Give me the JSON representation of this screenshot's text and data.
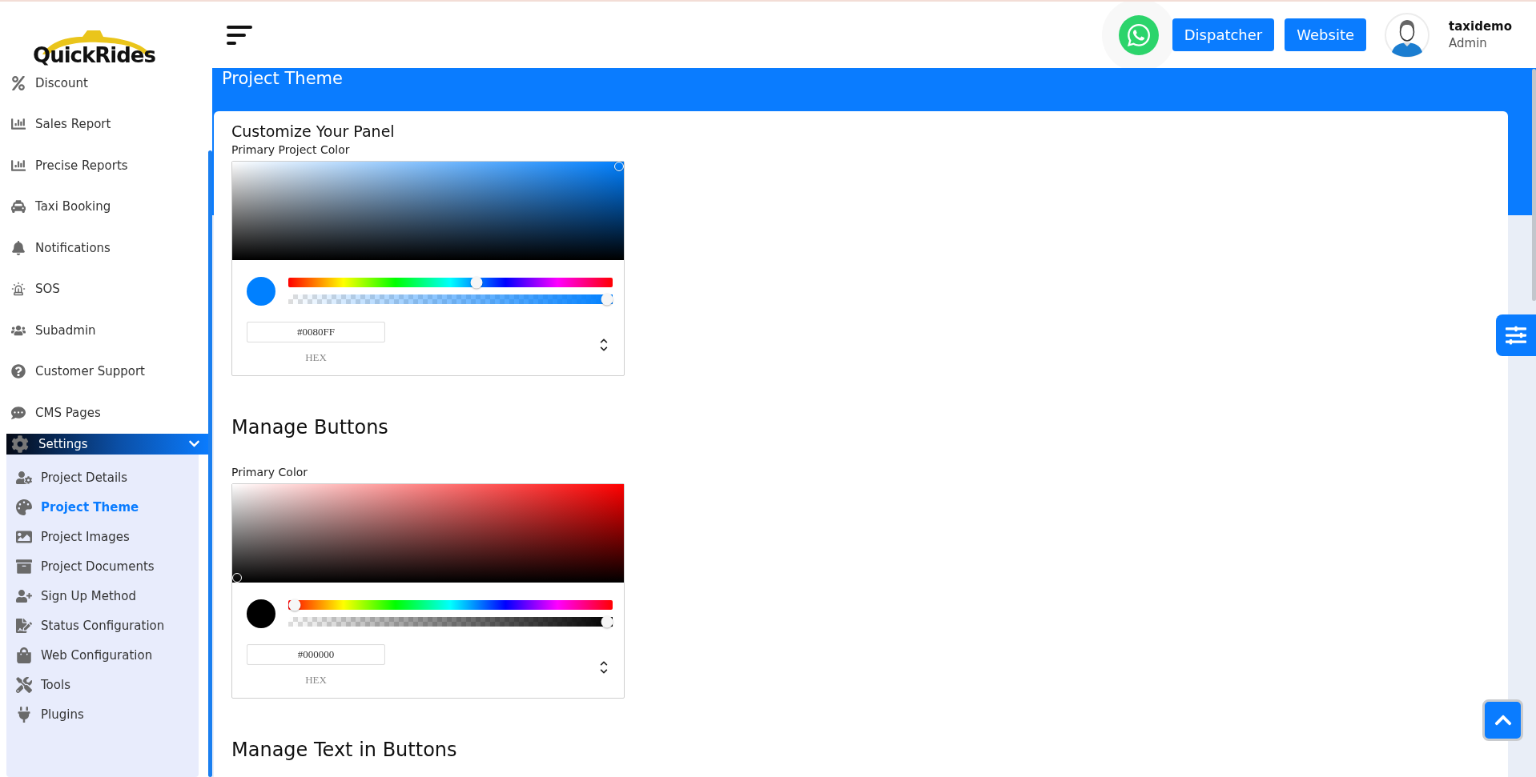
{
  "logo": {
    "text": "QuickRides"
  },
  "header": {
    "buttons": [
      "Dispatcher",
      "Website"
    ],
    "user": {
      "name": "taxidemo",
      "role": "Admin"
    }
  },
  "sidebar": {
    "items": [
      {
        "label": "Discount",
        "selected": false
      },
      {
        "label": "Sales Report",
        "selected": false
      },
      {
        "label": "Precise Reports",
        "selected": false
      },
      {
        "label": "Taxi Booking",
        "selected": false
      },
      {
        "label": "Notifications",
        "selected": false
      },
      {
        "label": "SOS",
        "selected": false
      },
      {
        "label": "Subadmin",
        "selected": false
      },
      {
        "label": "Customer Support",
        "selected": false
      },
      {
        "label": "CMS Pages",
        "selected": false
      }
    ],
    "settings": {
      "label": "Settings",
      "selected": true,
      "expanded": true,
      "children": [
        {
          "label": "Project Details",
          "selected": false
        },
        {
          "label": "Project Theme",
          "selected": true
        },
        {
          "label": "Project Images",
          "selected": false
        },
        {
          "label": "Project Documents",
          "selected": false
        },
        {
          "label": "Sign Up Method",
          "selected": false
        },
        {
          "label": "Status Configuration",
          "selected": false
        },
        {
          "label": "Web Configuration",
          "selected": false
        },
        {
          "label": "Tools",
          "selected": false
        },
        {
          "label": "Plugins",
          "selected": false
        }
      ]
    }
  },
  "page_title": "Project Theme",
  "panel": {
    "heading": "Customize Your Panel",
    "picker": {
      "label": "Primary Project Color",
      "color": "#0080ff",
      "hex": "#0080FF",
      "format": "HEX",
      "hue_slider": {
        "level": 0.583
      },
      "alpha_slider": {
        "level": 1
      }
    }
  },
  "sections": [
    {
      "heading": "Manage Buttons",
      "picker": {
        "label": "Primary Color",
        "color": "#000000",
        "hex": "#000000",
        "format": "HEX",
        "hue_slider": {
          "level": 0
        },
        "alpha_slider": {
          "level": 1
        }
      }
    },
    {
      "heading": "Manage Text in Buttons"
    }
  ]
}
